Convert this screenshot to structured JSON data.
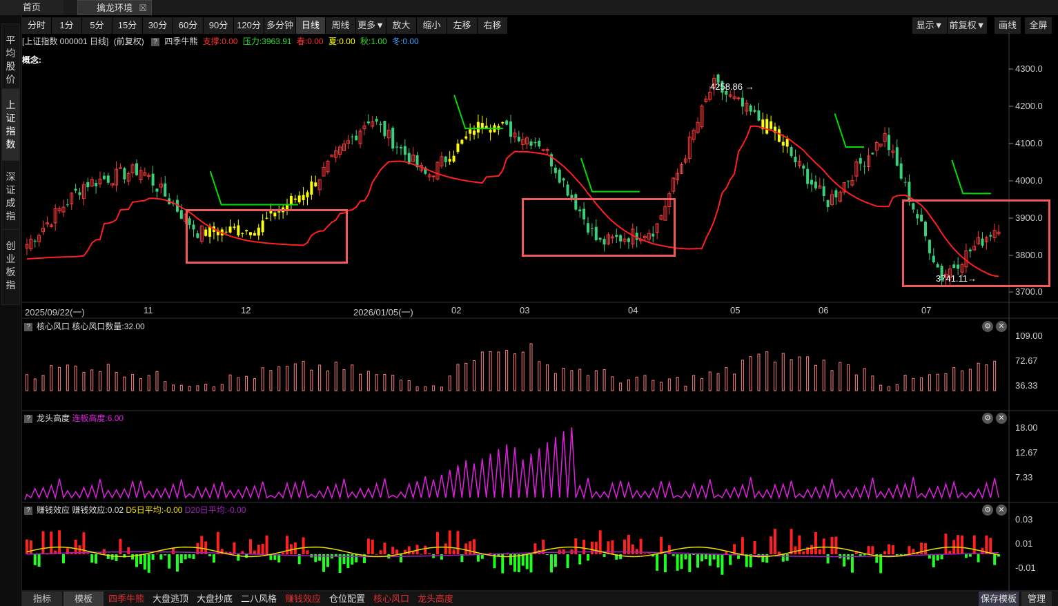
{
  "tabs": {
    "home": "首页",
    "env": "擒龙环境",
    "close": "☒"
  },
  "sidebar": [
    {
      "label": "平均股价",
      "lines": [
        "平",
        "均",
        "股",
        "价"
      ]
    },
    {
      "label": "上证指数",
      "lines": [
        "上",
        "证",
        "指",
        "数"
      ],
      "active": true
    },
    {
      "label": "深证成指",
      "lines": [
        "深",
        "证",
        "成",
        "指"
      ]
    },
    {
      "label": "创业板指",
      "lines": [
        "创",
        "业",
        "板",
        "指"
      ]
    }
  ],
  "toolbar": {
    "periods": [
      "分时",
      "1分",
      "5分",
      "15分",
      "30分",
      "60分",
      "90分",
      "120分",
      "多分钟",
      "日线",
      "周线",
      "更多▼",
      "放大",
      "缩小",
      "左移",
      "右移"
    ],
    "active_period": "日线",
    "right": [
      "显示▼",
      "前复权▼",
      "画线",
      "全屏"
    ]
  },
  "info": {
    "symbol": "[上证指数 000001 日线]",
    "adjust": "(前复权)",
    "q": "?",
    "indicator": "四季牛熊",
    "support": "支撑:0.00",
    "pressure": "压力:3963.91",
    "spring": "春:0.00",
    "summer": "夏:0.00",
    "autumn": "秋:1.00",
    "winter": "冬:0.00",
    "concept": "概念:"
  },
  "price_axis": [
    "4300.0",
    "4200.0",
    "4100.0",
    "4000.0",
    "3900.0",
    "3800.0",
    "3700.0"
  ],
  "date_axis": [
    "2025/09/22(一)",
    "11",
    "12",
    "2026/01/05(一)",
    "02",
    "03",
    "04",
    "05",
    "06",
    "07"
  ],
  "annotations": {
    "high": "4258.86",
    "low": "3741.11"
  },
  "panels": {
    "core": {
      "name": "核心风口",
      "value": "核心风口数量:32.00",
      "axis": [
        "109.00",
        "72.67",
        "36.33"
      ]
    },
    "dragon": {
      "name": "龙头高度",
      "value": "连板高度:6.00",
      "axis": [
        "18.00",
        "12.67",
        "7.33"
      ]
    },
    "money": {
      "name": "赚钱效应",
      "value": "赚钱效应:0.02",
      "d5": "D5日平均:-0.00",
      "d20": "D20日平均:-0.00",
      "axis": [
        "0.03",
        "0.01",
        "-0.01"
      ]
    }
  },
  "bottom": [
    {
      "label": "指标",
      "color": "#dddddd"
    },
    {
      "label": "模板",
      "color": "#dddddd"
    },
    {
      "label": "四季牛熊",
      "color": "#e03030"
    },
    {
      "label": "大盘逃顶",
      "color": "#dddddd"
    },
    {
      "label": "大盘抄底",
      "color": "#dddddd"
    },
    {
      "label": "二八风格",
      "color": "#dddddd"
    },
    {
      "label": "赚钱效应",
      "color": "#e03030"
    },
    {
      "label": "仓位配置",
      "color": "#dddddd"
    },
    {
      "label": "核心风口",
      "color": "#e03030"
    },
    {
      "label": "龙头高度",
      "color": "#e03030"
    }
  ],
  "bottom_right": [
    "保存模板",
    "管理"
  ],
  "colors": {
    "up": "#ff3a3a",
    "down": "#3ad07a",
    "summer": "#ffff00",
    "support": "#ff2020",
    "pressure": "#00e000",
    "magenta": "#e020e0",
    "yellow": "#f0e000",
    "purple": "#a020c0"
  },
  "chart_data": [
    {
      "type": "candlestick",
      "title": "上证指数 000001 日线",
      "ylim": [
        3680,
        4330
      ],
      "y_ticks": [
        3700,
        3800,
        3900,
        4000,
        4100,
        4200,
        4300
      ],
      "x_labels": [
        "2025/09/22(一)",
        "11",
        "12",
        "2026/01/05(一)",
        "02",
        "03",
        "04",
        "05",
        "06",
        "07"
      ],
      "key_points": [
        {
          "date": "2025/09/22",
          "close": 3828
        },
        {
          "date": "2025/10 mid",
          "close": 3990
        },
        {
          "date": "2025/11 mid",
          "close": 4030
        },
        {
          "date": "2025/11 end",
          "close": 3860
        },
        {
          "date": "2025/12 mid",
          "close": 3870
        },
        {
          "date": "2026/01/05",
          "close": 3990
        },
        {
          "date": "2026/01 mid",
          "close": 4170
        },
        {
          "date": "2026/02 early",
          "close": 4010
        },
        {
          "date": "2026/02 end",
          "close": 4160
        },
        {
          "date": "2026/03 mid",
          "close": 4100
        },
        {
          "date": "2026/03 end",
          "close": 3830
        },
        {
          "date": "2026/04 mid",
          "close": 3870
        },
        {
          "date": "2026/05 early",
          "close": 4258.86
        },
        {
          "date": "2026/05 mid",
          "close": 4140
        },
        {
          "date": "2026/06 early",
          "close": 3940
        },
        {
          "date": "2026/06 end",
          "close": 4120
        },
        {
          "date": "2026/07 mid",
          "close": 3741.11
        },
        {
          "date": "2026/07 end",
          "close": 3880
        }
      ]
    },
    {
      "type": "bar",
      "title": "核心风口",
      "ylim": [
        0,
        109
      ],
      "y_ticks": [
        36.33,
        72.67,
        109.0
      ],
      "last": 32.0
    },
    {
      "type": "area",
      "title": "龙头高度",
      "ylim": [
        0,
        18
      ],
      "y_ticks": [
        7.33,
        12.67,
        18.0
      ],
      "peak": 18.0,
      "last": 6.0
    },
    {
      "type": "bar",
      "title": "赚钱效应",
      "ylim": [
        -0.03,
        0.03
      ],
      "y_ticks": [
        -0.01,
        0.01,
        0.03
      ],
      "last": 0.02
    }
  ]
}
